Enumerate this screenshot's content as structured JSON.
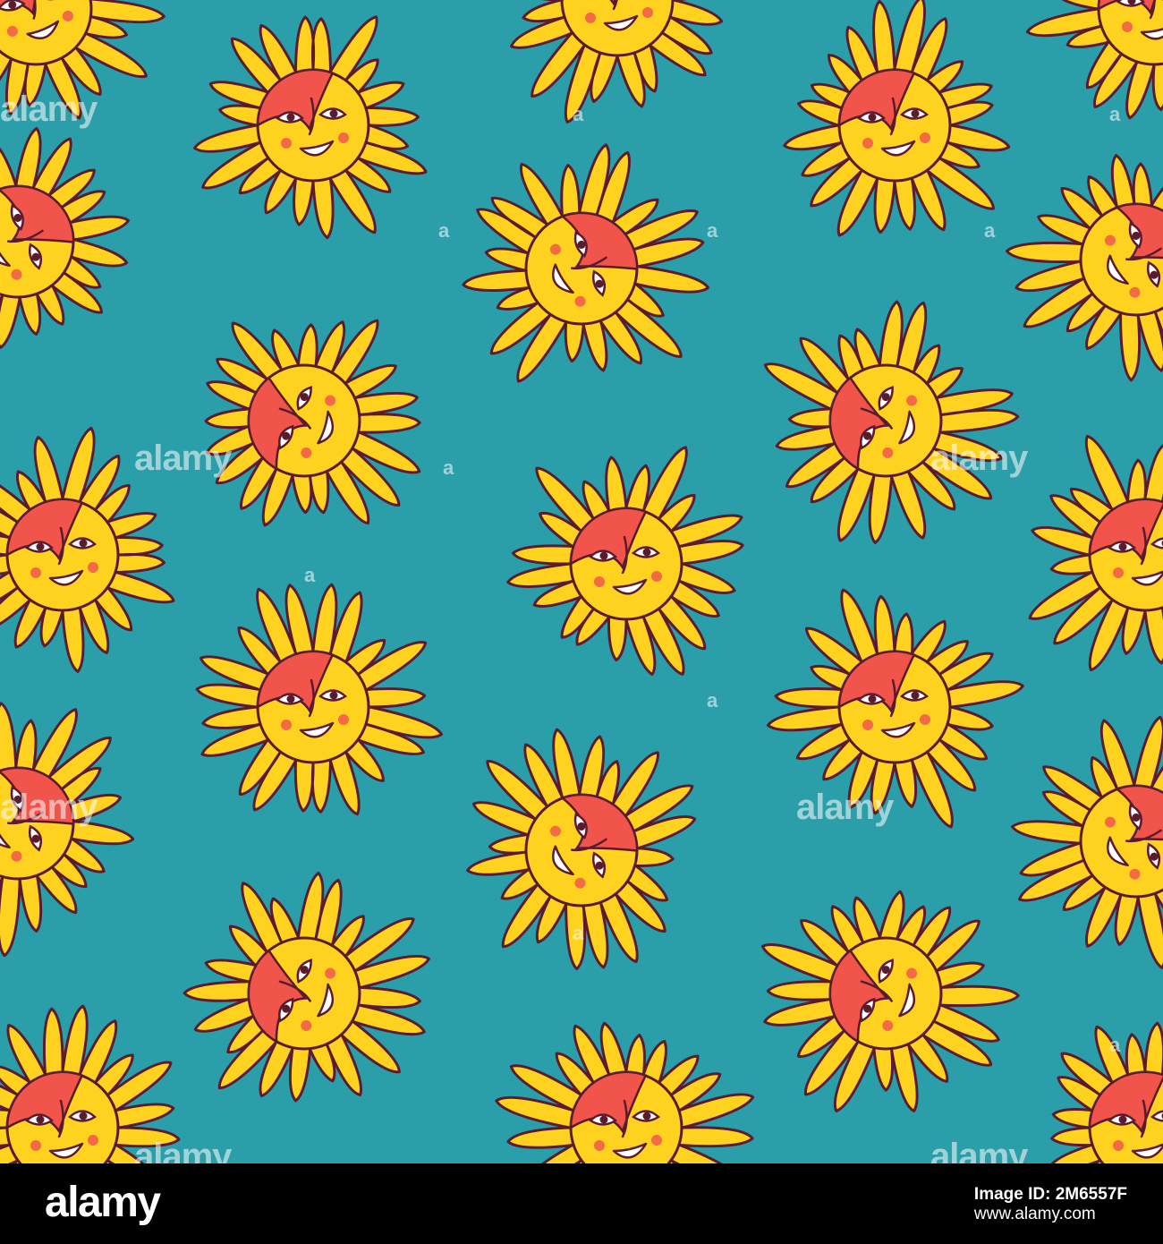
{
  "pattern": {
    "background": "#2a9ea9",
    "ray_color": "#ffd21f",
    "face_color": "#ffd21f",
    "mask_color": "#f0544a",
    "outline_color": "#5a1b2e",
    "cheek_color": "#f46a45",
    "motif": "smiling-sun-face",
    "watermark_text": "alamy",
    "watermark_mark": "a"
  },
  "footer": {
    "logo": "alamy",
    "image_id": "Image ID: 2M6557F",
    "url": "www.alamy.com"
  }
}
